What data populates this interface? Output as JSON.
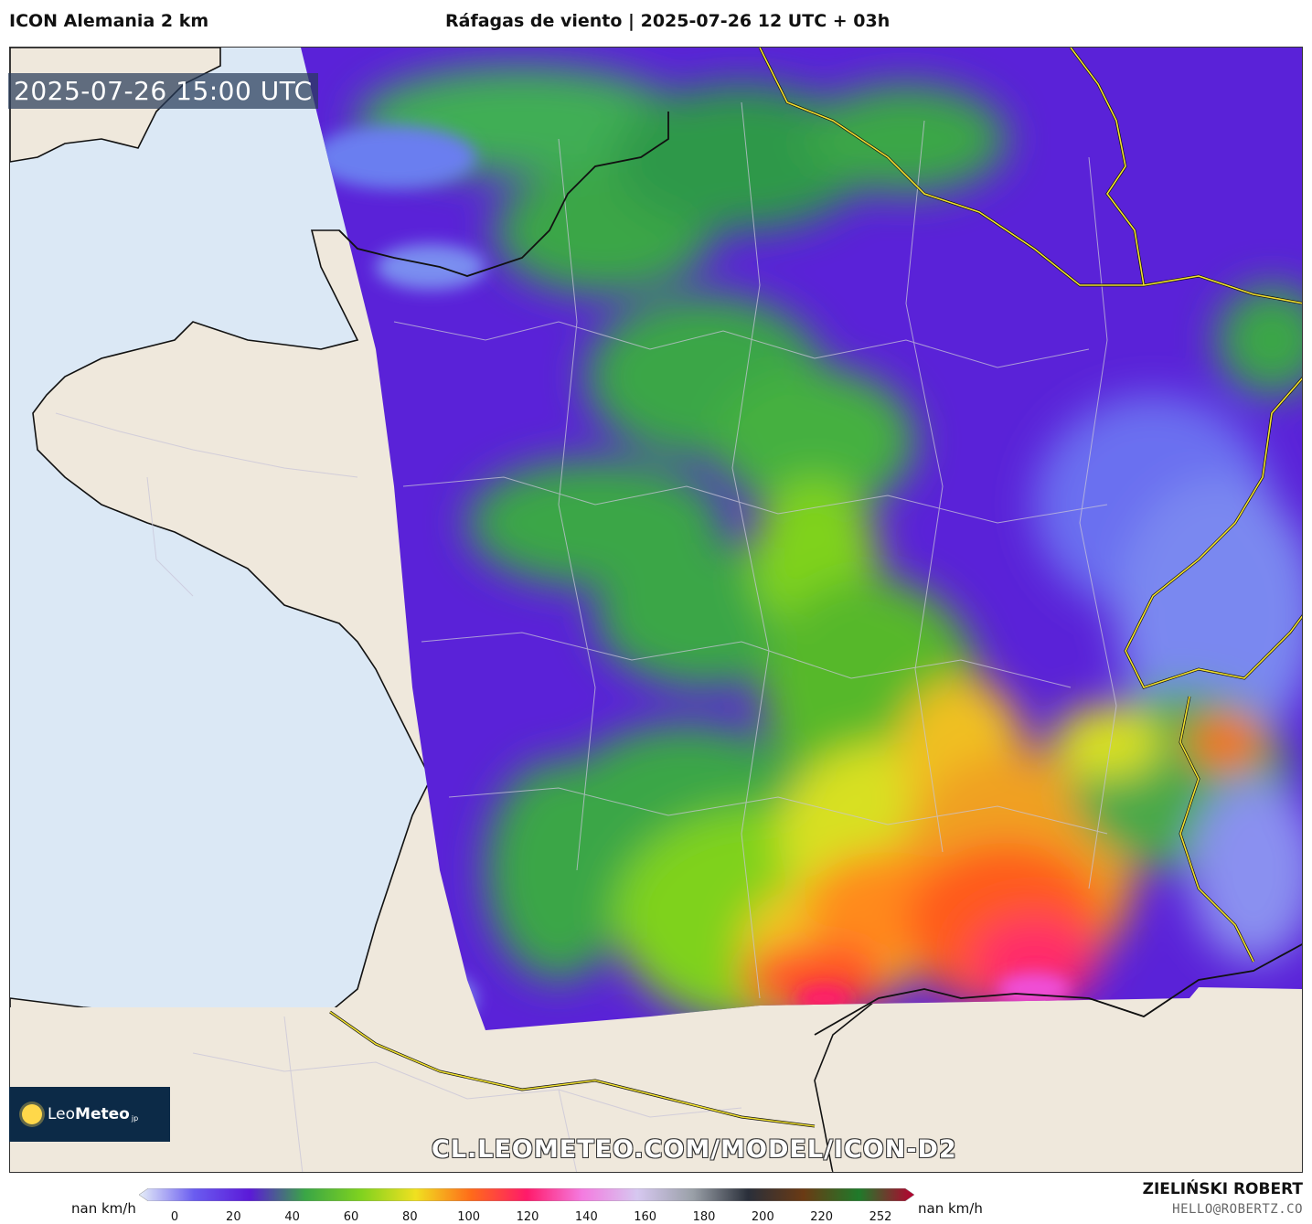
{
  "header": {
    "model": "ICON Alemania 2 km",
    "title": "Ráfagas de viento | 2025-07-26 12 UTC + 03h"
  },
  "map": {
    "valid_time": "2025-07-26 15:00 UTC",
    "watermark": "CL.LEOMETEO.COM/MODEL/ICON-D2",
    "colors": {
      "sea": "#dbe8f5",
      "land": "#efe8dc",
      "border": "#f0e030"
    }
  },
  "logo": {
    "brand_light": "Leo",
    "brand_bold": "Meteo",
    "suffix": "jp"
  },
  "legend": {
    "unit_left": "nan km/h",
    "unit_right": "nan km/h",
    "ticks": [
      "0",
      "20",
      "40",
      "60",
      "80",
      "100",
      "120",
      "140",
      "160",
      "180",
      "200",
      "220",
      "252"
    ],
    "colors": [
      "#e6eef8",
      "#6a5cf0",
      "#5b19d8",
      "#3aa646",
      "#7fd21f",
      "#f0e020",
      "#ff6a1a",
      "#ff1a6a",
      "#f47be0",
      "#d6c8f0",
      "#9aa0a8",
      "#2a2f3a",
      "#6a3a14",
      "#1f7a2a",
      "#b80030"
    ]
  },
  "footer": {
    "author": "ZIELIŃSKI ROBERT",
    "email": "HELLO@ROBERTZ.CO"
  }
}
